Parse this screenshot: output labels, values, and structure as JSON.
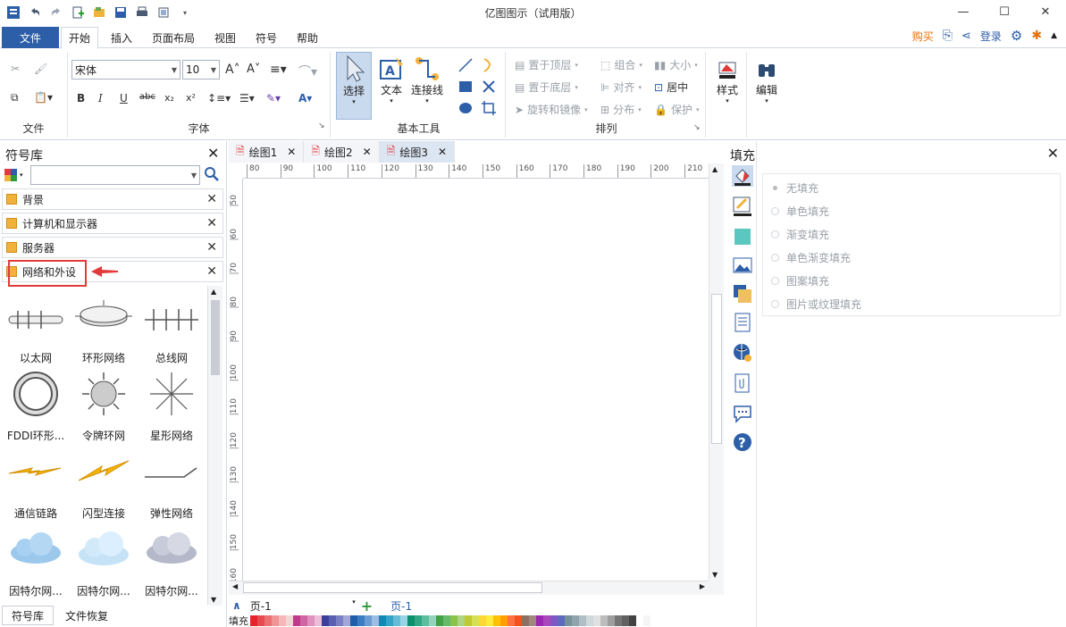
{
  "window": {
    "title": "亿图图示（试用版）"
  },
  "menu": {
    "file": "文件",
    "items": [
      "开始",
      "插入",
      "页面布局",
      "视图",
      "符号",
      "帮助"
    ],
    "buy": "购买",
    "login": "登录"
  },
  "ribbon": {
    "groups": {
      "file": "文件",
      "font": "字体",
      "basic_tools": "基本工具",
      "arrange": "排列"
    },
    "font_name": "宋体",
    "font_size": "10",
    "tools": {
      "select": "选择",
      "text": "文本",
      "connector": "连接线"
    },
    "arrange": {
      "bring_front": "置于顶层",
      "send_back": "置于底层",
      "rotate_mirror": "旋转和镜像",
      "group": "组合",
      "align": "对齐",
      "distribute": "分布",
      "size": "大小",
      "center": "居中",
      "protect": "保护"
    },
    "style": "样式",
    "edit": "编辑"
  },
  "library": {
    "title": "符号库",
    "categories": [
      "背景",
      "计算机和显示器",
      "服务器",
      "网络和外设"
    ],
    "shapes": [
      {
        "label": "以太网",
        "icon": "ethernet-icon"
      },
      {
        "label": "环形网络",
        "icon": "ring-network-icon"
      },
      {
        "label": "总线网",
        "icon": "bus-network-icon"
      },
      {
        "label": "FDDI环形...",
        "icon": "fddi-ring-icon"
      },
      {
        "label": "令牌环网",
        "icon": "token-ring-icon"
      },
      {
        "label": "星形网络",
        "icon": "star-network-icon"
      },
      {
        "label": "通信链路",
        "icon": "comm-link-icon"
      },
      {
        "label": "闪型连接",
        "icon": "lightning-link-icon"
      },
      {
        "label": "弹性网络",
        "icon": "elastic-network-icon"
      },
      {
        "label": "因特尔网...",
        "icon": "cloud-icon"
      },
      {
        "label": "因特尔网...",
        "icon": "cloud-icon"
      },
      {
        "label": "因特尔网...",
        "icon": "cloud-icon"
      }
    ],
    "bottom_tabs": [
      "符号库",
      "文件恢复"
    ]
  },
  "doc_tabs": [
    "绘图1",
    "绘图2",
    "绘图3"
  ],
  "ruler": {
    "h": [
      "80",
      "90",
      "100",
      "110",
      "120",
      "130",
      "140",
      "150",
      "160",
      "170",
      "180",
      "190",
      "200",
      "210"
    ],
    "v": [
      "50",
      "60",
      "70",
      "80",
      "90",
      "100",
      "110",
      "120",
      "130",
      "140",
      "150",
      "160"
    ]
  },
  "page": {
    "selector": "页-1",
    "tab": "页-1",
    "fill_label": "填充"
  },
  "fill": {
    "title": "填充",
    "options": [
      "无填充",
      "单色填充",
      "渐变填充",
      "单色渐变填充",
      "图案填充",
      "图片或纹理填充"
    ]
  },
  "palette_colors": [
    "#e2262c",
    "#e84b4f",
    "#ec6f72",
    "#f19596",
    "#f4b8b9",
    "#f7d3d3",
    "#c0398a",
    "#d065a3",
    "#e091bf",
    "#ecbcd9",
    "#3a3f9e",
    "#5a5fb2",
    "#7b80c5",
    "#a3a6d8",
    "#1d5fa8",
    "#3c7cc0",
    "#6b9bd2",
    "#9dbde2",
    "#0e8bb5",
    "#34a3c7",
    "#67bbd6",
    "#9ad3e6",
    "#0b8f6c",
    "#2fa684",
    "#5fbd9f",
    "#95d3bd",
    "#43a047",
    "#66bb6a",
    "#8bc34a",
    "#aed581",
    "#c0ca33",
    "#d4e157",
    "#fdd835",
    "#ffeb3b",
    "#ffc107",
    "#ffa000",
    "#ff7043",
    "#f4511e",
    "#8d6e63",
    "#a1887f",
    "#9c27b0",
    "#ab47bc",
    "#7e57c2",
    "#5c6bc0",
    "#78909c",
    "#90a4ae",
    "#b0bec5",
    "#cfd8dc",
    "#e0e0e0",
    "#bdbdbd",
    "#9e9e9e",
    "#757575",
    "#616161",
    "#424242",
    "#ffffff",
    "#f5f5f5"
  ]
}
